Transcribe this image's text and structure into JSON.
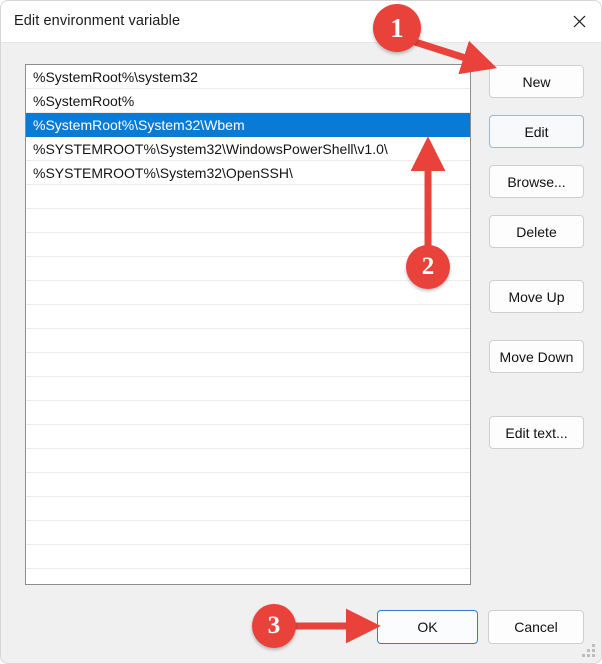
{
  "window": {
    "title": "Edit environment variable",
    "close_icon": "close-icon"
  },
  "list": {
    "items": [
      {
        "text": "%SystemRoot%\\system32",
        "selected": false
      },
      {
        "text": "%SystemRoot%",
        "selected": false
      },
      {
        "text": "%SystemRoot%\\System32\\Wbem",
        "selected": true
      },
      {
        "text": "%SYSTEMROOT%\\System32\\WindowsPowerShell\\v1.0\\",
        "selected": false
      },
      {
        "text": "%SYSTEMROOT%\\System32\\OpenSSH\\",
        "selected": false
      }
    ],
    "empty_row_count": 16,
    "selection_color": "#0a7bd4"
  },
  "side_buttons": {
    "new": "New",
    "edit": "Edit",
    "browse": "Browse...",
    "delete": "Delete",
    "move_up": "Move Up",
    "move_down": "Move Down",
    "edit_text": "Edit text..."
  },
  "footer": {
    "ok": "OK",
    "cancel": "Cancel"
  },
  "annotations": {
    "accent_color": "#e8423b",
    "markers": [
      {
        "label": "1",
        "points_to": "New",
        "arrow": "diagonal-down-right"
      },
      {
        "label": "2",
        "points_to": "list-selected-area",
        "arrow": "up"
      },
      {
        "label": "3",
        "points_to": "OK",
        "arrow": "right"
      }
    ]
  }
}
